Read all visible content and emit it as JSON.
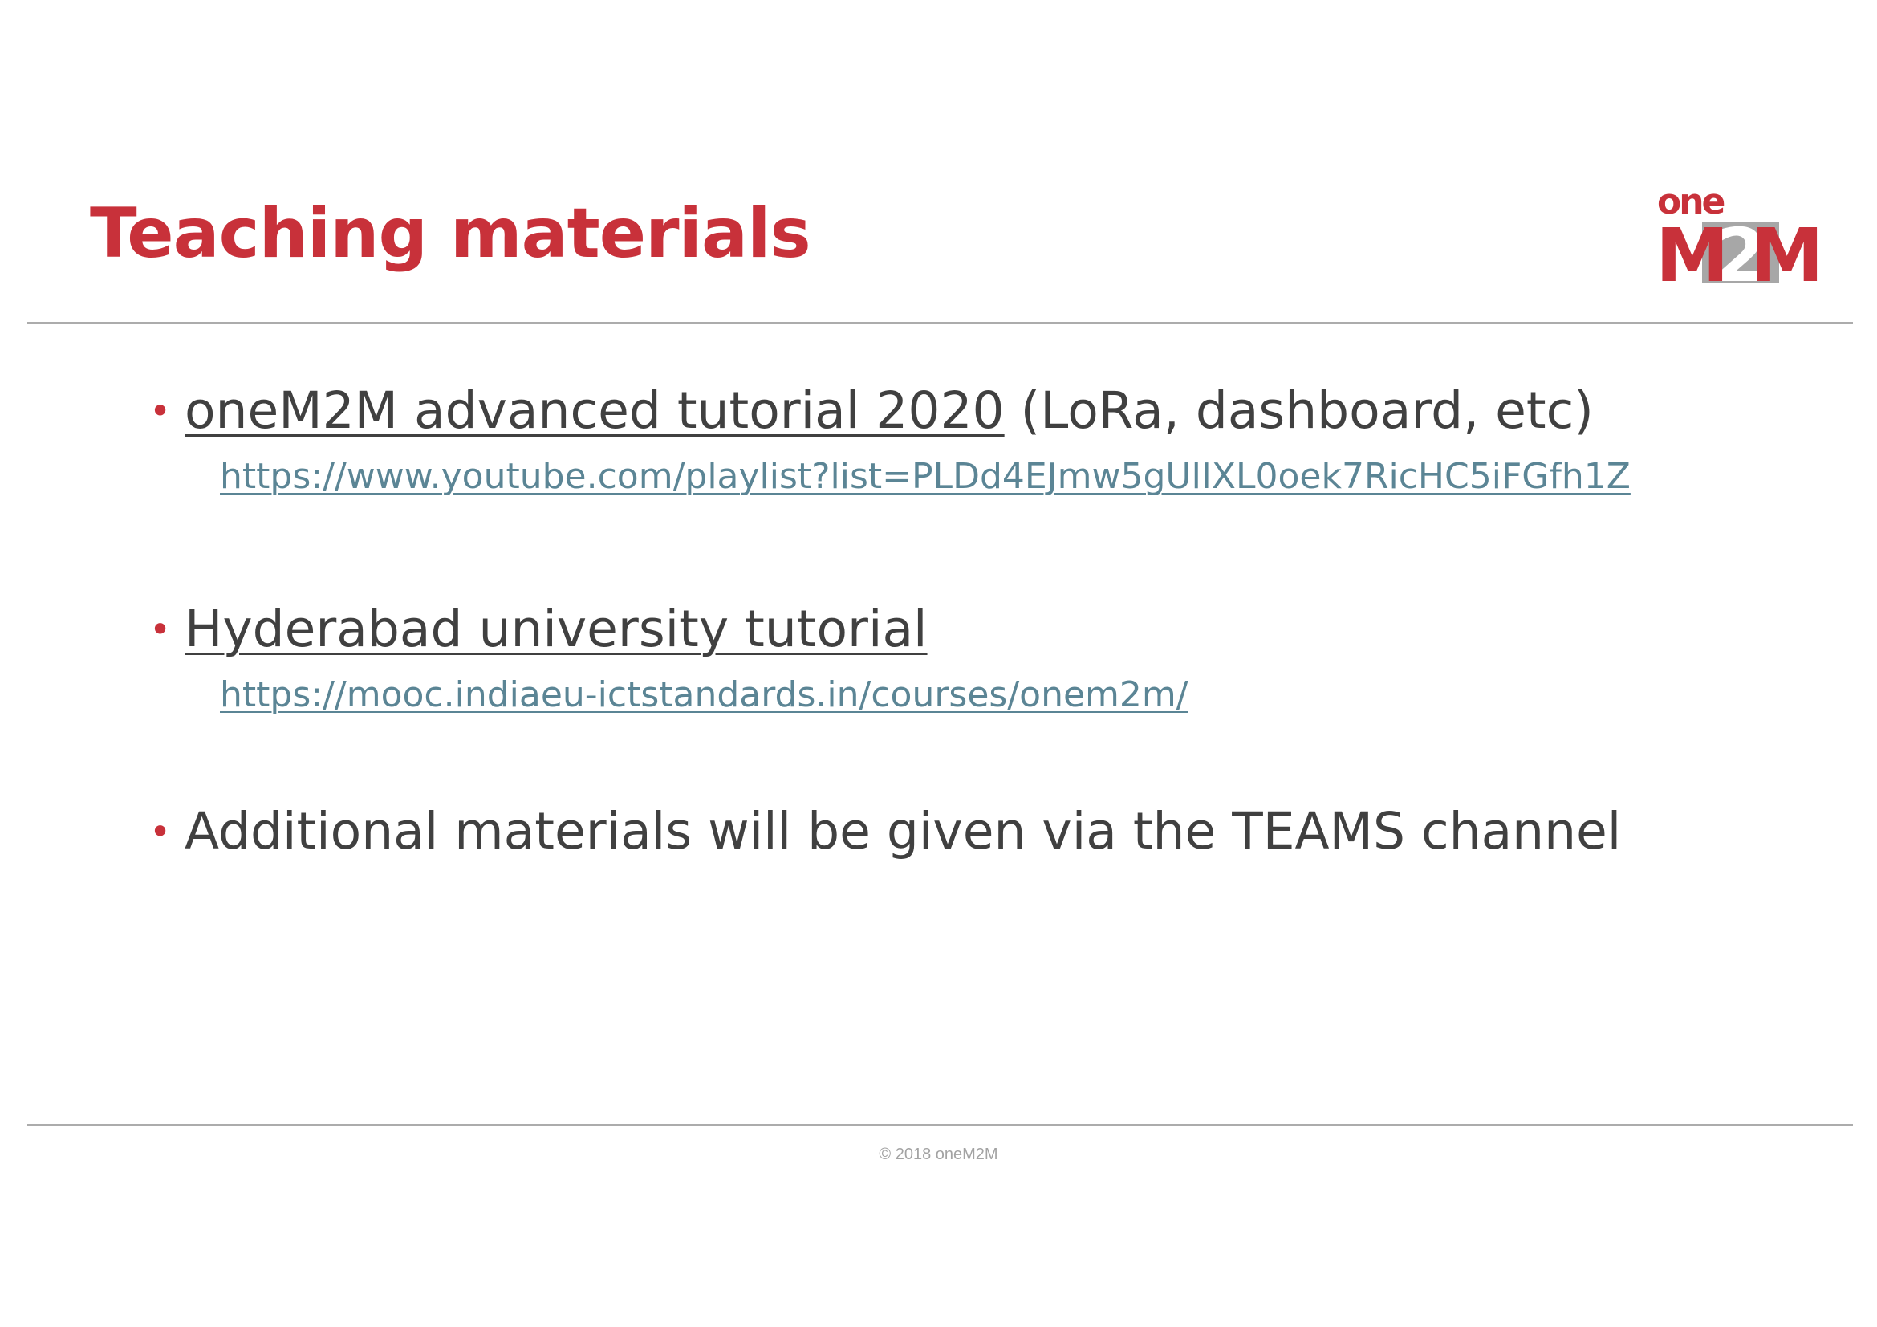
{
  "slide": {
    "title": "Teaching materials",
    "logo": {
      "name": "oneM2M-logo",
      "top_text": "one",
      "letters": [
        "M",
        "2",
        "M"
      ],
      "colors": {
        "red": "#c8313a",
        "gray": "#a7a7a7"
      }
    },
    "bullets": [
      {
        "link_text": "oneM2M advanced tutorial 2020",
        "rest_text": " (LoRa, dashboard, etc)",
        "url": "https://www.youtube.com/playlist?list=PLDd4EJmw5gUlIXL0oek7RicHC5iFGfh1Z"
      },
      {
        "link_text": "Hyderabad university tutorial",
        "url": "https://mooc.indiaeu-ictstandards.in/courses/onem2m/"
      },
      {
        "text": "Additional materials will be given via the TEAMS channel"
      }
    ],
    "footer": "© 2018 oneM2M",
    "colors": {
      "title": "#c8313a",
      "bullet_dot": "#c8313a",
      "body_text": "#404040",
      "url": "#5b8595",
      "rule": "#acacac",
      "footer": "#a3a3a3"
    }
  }
}
